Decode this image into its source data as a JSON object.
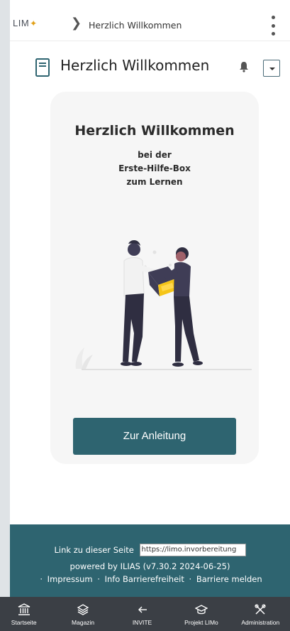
{
  "topbar": {
    "logo_text": "LIM",
    "logo_mark": "☠",
    "chevron": "❯",
    "breadcrumb": "Herzlich Willkommen",
    "kebab_icon": "vertical-ellipsis-icon"
  },
  "title_row": {
    "title": "Herzlich Willkommen",
    "page_icon": "document-icon",
    "bell_icon": "bell-icon",
    "dropdown_icon": "caret-down-icon"
  },
  "card": {
    "heading": "Herzlich Willkommen",
    "sub_line1": "bei der",
    "sub_line2": "Erste-Hilfe-Box",
    "sub_line3": "zum Lernen",
    "cta_label": "Zur Anleitung"
  },
  "footer": {
    "link_label": "Link zu dieser Seite",
    "link_value": "https://limo.invorbereitung",
    "powered": "powered by ILIAS (v7.30.2 2024-06-25)",
    "links": [
      "Impressum",
      "Info Barrierefreiheit",
      "Barriere melden"
    ]
  },
  "bottom_nav": [
    {
      "label": "Startseite",
      "icon": "bank-icon"
    },
    {
      "label": "Magazin",
      "icon": "layers-icon"
    },
    {
      "label": "INVITE",
      "icon": "arrow-left-icon"
    },
    {
      "label": "Projekt LIMo",
      "icon": "graduation-cap-icon"
    },
    {
      "label": "Administration",
      "icon": "tools-icon"
    }
  ],
  "colors": {
    "primary": "#2e6470",
    "card_bg": "#f6f6f6",
    "nav_bg": "#3b3f45",
    "accent_yellow": "#f5c518"
  }
}
